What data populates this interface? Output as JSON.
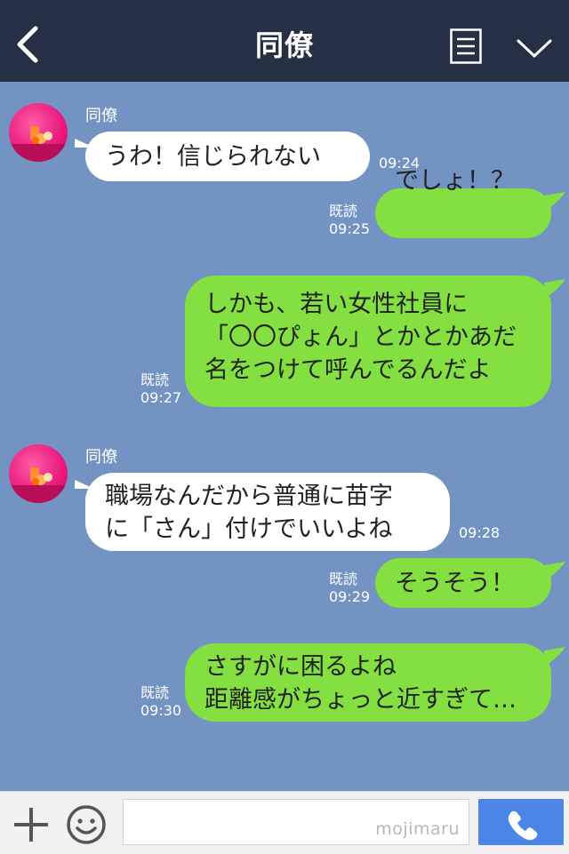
{
  "header": {
    "title": "同僚",
    "back_icon": "chevron-left-icon",
    "menu_icon": "menu-list-icon",
    "collapse_icon": "chevron-down-icon"
  },
  "messages": [
    {
      "direction": "in",
      "sender": "同僚",
      "lines": [
        "うわ！信じられない"
      ],
      "time": "09:24"
    },
    {
      "direction": "out",
      "read": "既読",
      "lines": [
        "でしょ！？"
      ],
      "time": "09:25"
    },
    {
      "direction": "out",
      "read": "既読",
      "lines": [
        "しかも、若い女性社員に",
        "「〇〇ぴょん」とかとかあだ",
        "名をつけて呼んでるんだよ"
      ],
      "time": "09:27"
    },
    {
      "direction": "in",
      "sender": "同僚",
      "lines": [
        "職場なんだから普通に苗字",
        "に「さん」付けでいいよね"
      ],
      "time": "09:28"
    },
    {
      "direction": "out",
      "read": "既読",
      "lines": [
        "そうそう！"
      ],
      "time": "09:29"
    },
    {
      "direction": "out",
      "read": "既読",
      "lines": [
        "さすがに困るよね",
        "距離感がちょっと近すぎて…"
      ],
      "time": "09:30"
    }
  ],
  "input": {
    "placeholder": "",
    "watermark": "mojimaru",
    "plus_icon": "plus-icon",
    "emoji_icon": "smiley-icon",
    "call_icon": "phone-icon"
  },
  "colors": {
    "header_bg": "#263044",
    "chat_bg": "#7394c3",
    "incoming_bubble": "#ffffff",
    "outgoing_bubble": "#84e040",
    "call_button": "#4b86e6"
  }
}
